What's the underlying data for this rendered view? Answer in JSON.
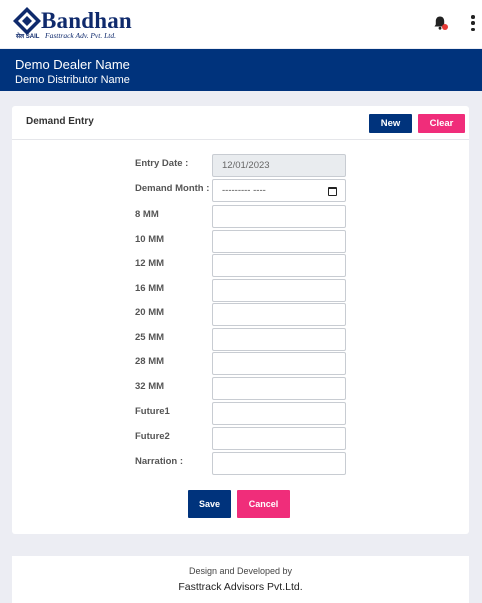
{
  "header": {
    "brand_name": "Bandhan",
    "brand_sail": "सेल SAIL",
    "brand_sub": "Fasttrack Adv. Pvt. Ltd."
  },
  "info_bar": {
    "dealer_name": "Demo Dealer Name",
    "distributor_name": "Demo Distributor Name"
  },
  "card": {
    "title": "Demand Entry",
    "new_label": "New",
    "clear_label": "Clear"
  },
  "form": {
    "entry_date_label": "Entry Date :",
    "entry_date_value": "12/01/2023",
    "demand_month_label": "Demand Month :",
    "demand_month_value": "--------- ----",
    "fields": [
      {
        "label": "8 MM",
        "value": ""
      },
      {
        "label": "10 MM",
        "value": ""
      },
      {
        "label": "12 MM",
        "value": ""
      },
      {
        "label": "16 MM",
        "value": ""
      },
      {
        "label": "20 MM",
        "value": ""
      },
      {
        "label": "25 MM",
        "value": ""
      },
      {
        "label": "28 MM",
        "value": ""
      },
      {
        "label": "32 MM",
        "value": ""
      },
      {
        "label": "Future1",
        "value": ""
      },
      {
        "label": "Future2",
        "value": ""
      },
      {
        "label": "Narration :",
        "value": ""
      }
    ],
    "save_label": "Save",
    "cancel_label": "Cancel"
  },
  "footer": {
    "line1": "Design and Developed by",
    "line2": "Fasttrack Advisors Pvt.Ltd."
  },
  "colors": {
    "primary": "#00337c",
    "accent": "#f02d7a",
    "notification_dot": "#e53935",
    "page_bg": "#ecedf3"
  },
  "icons": [
    "bandhan-logo-icon",
    "bell-icon",
    "more-vertical-icon",
    "calendar-icon"
  ]
}
